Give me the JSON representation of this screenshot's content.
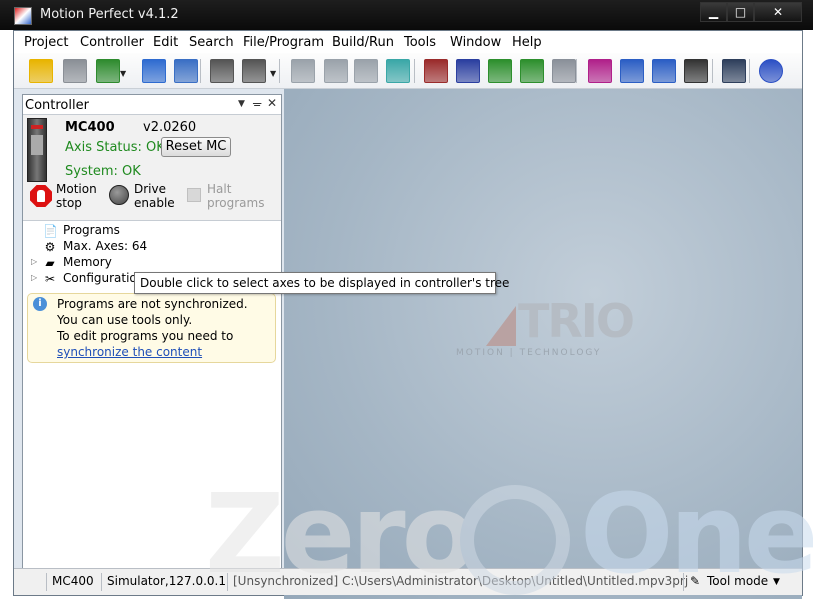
{
  "window": {
    "title": "Motion Perfect v4.1.2",
    "min_glyph": "▁",
    "max_glyph": "□",
    "close_glyph": "✕"
  },
  "menu": {
    "items": [
      "Project",
      "Controller",
      "Edit",
      "Search",
      "File/Program",
      "Build/Run",
      "Tools",
      "Window",
      "Help"
    ]
  },
  "toolbar": {
    "buttons": [
      {
        "name": "open-project-icon",
        "color": "#e8b400"
      },
      {
        "name": "save-icon",
        "color": "#8a8f96"
      },
      {
        "name": "connect-icon",
        "color": "#2e8b2e"
      },
      {
        "name": "sync-icon",
        "color": "#2e6bd0"
      },
      {
        "name": "clock-icon",
        "color": "#3a6fc4"
      },
      {
        "name": "terminal-icon",
        "color": "#555555"
      },
      {
        "name": "window-icon",
        "color": "#555555"
      },
      {
        "name": "axis-params-icon",
        "color": "#9aa2aa"
      },
      {
        "name": "io-icon",
        "color": "#9aa2aa"
      },
      {
        "name": "analog-icon",
        "color": "#9aa2aa"
      },
      {
        "name": "robot-icon",
        "color": "#3aa7a7"
      },
      {
        "name": "jog-icon",
        "color": "#9a2b2b"
      },
      {
        "name": "scope-icon",
        "color": "#2b3fa0"
      },
      {
        "name": "table-icon",
        "color": "#2d8f2d"
      },
      {
        "name": "list-icon",
        "color": "#2d8f2d"
      },
      {
        "name": "graph-icon",
        "color": "#8a9099"
      },
      {
        "name": "vr-table-icon",
        "color": "#b0208a"
      },
      {
        "name": "vr-icon",
        "color": "#2b5ec4"
      },
      {
        "name": "watch-icon",
        "color": "#2b5ec4"
      },
      {
        "name": "diagnostics-icon",
        "color": "#333333"
      },
      {
        "name": "settings-gear-icon",
        "color": "#2e3f5c"
      },
      {
        "name": "help-icon",
        "color": "#2b4fc4"
      }
    ],
    "dropdown_glyph": "▼"
  },
  "panel": {
    "title": "Controller",
    "controls": {
      "dropdown": "▼",
      "pin": "ᚚ",
      "close": "✕"
    },
    "controller_model": "MC400",
    "version": "v2.0260",
    "axis_status": "Axis Status: OK",
    "reset_label": "Reset MC",
    "system_status": "System: OK",
    "motion_stop": [
      "Motion",
      "stop"
    ],
    "drive_enable": [
      "Drive",
      "enable"
    ],
    "halt_programs": [
      "Halt",
      "programs"
    ]
  },
  "tree": {
    "items": [
      {
        "label": "Programs",
        "icon": "📄",
        "expandable": false
      },
      {
        "label": "Max. Axes: 64",
        "icon": "⚙",
        "expandable": false
      },
      {
        "label": "Memory",
        "icon": "▰",
        "expandable": true
      },
      {
        "label": "Configuratio",
        "icon": "✂",
        "expandable": true
      }
    ],
    "arrow_glyph": "▷"
  },
  "info": {
    "icon_glyph": "i",
    "line1": "Programs are not synchronized.",
    "line2": "You can use tools only.",
    "line3": "To edit programs you need to",
    "link": "synchronize the content"
  },
  "tooltip": "Double click to select axes to be displayed in controller's tree",
  "logo": {
    "brand": "TRIO",
    "tagline": "MOTION | TECHNOLOGY"
  },
  "statusbar": {
    "controller": "MC400",
    "connection": "Simulator,127.0.0.1",
    "project_path": "[Unsynchronized] C:\\Users\\Administrator\\Desktop\\Untitled\\Untitled.mpv3prj",
    "mode": "Tool mode",
    "mode_glyph": "▼"
  },
  "watermark": {
    "left": "Zero",
    "right": "One"
  }
}
